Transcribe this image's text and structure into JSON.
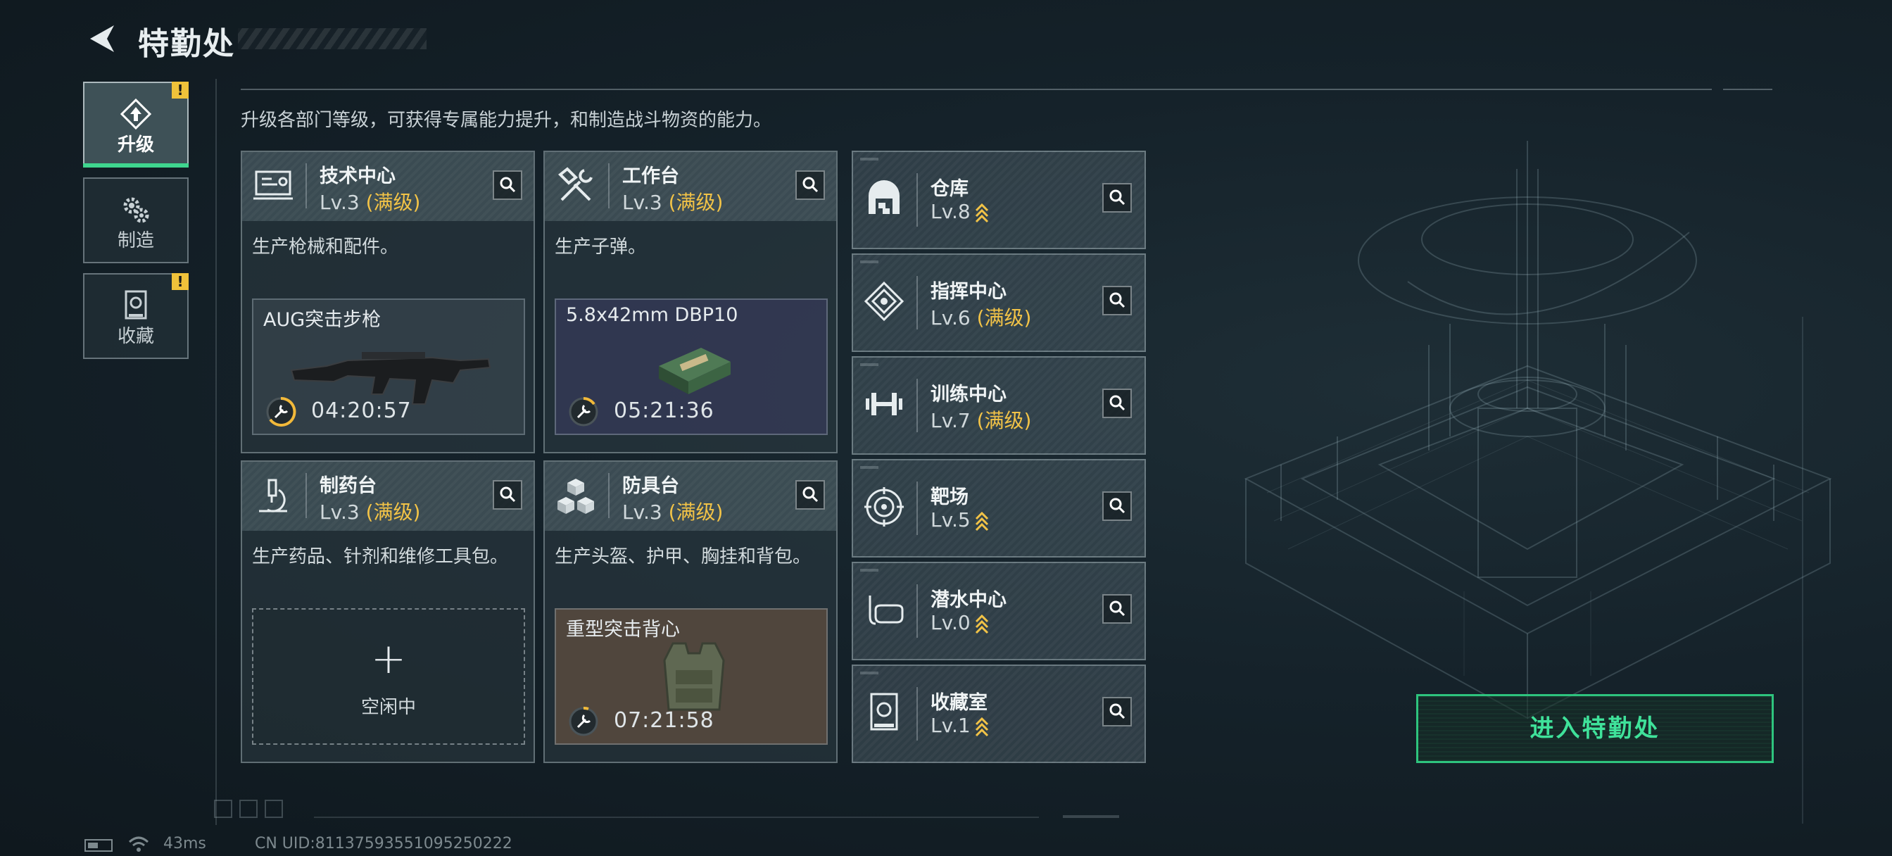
{
  "header": {
    "title": "特勤处"
  },
  "subtitle": "升级各部门等级，可获得专属能力提升，和制造战斗物资的能力。",
  "nav": [
    {
      "label": "升级",
      "icon": "upgrade-icon",
      "active": true,
      "alert": "!"
    },
    {
      "label": "制造",
      "icon": "gears-icon",
      "active": false
    },
    {
      "label": "收藏",
      "icon": "collection-icon",
      "active": false,
      "alert": "!"
    }
  ],
  "cards": [
    {
      "name": "技术中心",
      "level": "Lv.3",
      "maxed": "(满级)",
      "icon": "monitor-icon",
      "desc": "生产枪械和配件。",
      "item": "AUG突击步枪",
      "timer": "04:20:57"
    },
    {
      "name": "工作台",
      "level": "Lv.3",
      "maxed": "(满级)",
      "icon": "tools-icon",
      "desc": "生产子弹。",
      "item": "5.8x42mm DBP10",
      "timer": "05:21:36"
    },
    {
      "name": "制药台",
      "level": "Lv.3",
      "maxed": "(满级)",
      "icon": "microscope-icon",
      "desc": "生产药品、针剂和维修工具包。",
      "empty_plus": "+",
      "empty_label": "空闲中"
    },
    {
      "name": "防具台",
      "level": "Lv.3",
      "maxed": "(满级)",
      "icon": "cubes-icon",
      "desc": "生产头盔、护甲、胸挂和背包。",
      "item": "重型突击背心",
      "timer": "07:21:58"
    }
  ],
  "small_cards": [
    {
      "name": "仓库",
      "level": "Lv.8",
      "upgradable": true,
      "icon": "warehouse-icon"
    },
    {
      "name": "指挥中心",
      "level": "Lv.6",
      "maxed": "(满级)",
      "icon": "command-icon"
    },
    {
      "name": "训练中心",
      "level": "Lv.7",
      "maxed": "(满级)",
      "icon": "dumbbell-icon"
    },
    {
      "name": "靶场",
      "level": "Lv.5",
      "upgradable": true,
      "icon": "target-icon"
    },
    {
      "name": "潜水中心",
      "level": "Lv.0",
      "upgradable": true,
      "icon": "diving-mask-icon"
    },
    {
      "name": "收藏室",
      "level": "Lv.1",
      "upgradable": true,
      "icon": "display-case-icon"
    }
  ],
  "enter_button": "进入特勤处",
  "status": {
    "ping": "43ms",
    "uid": "CN UID:81137593551095250222"
  },
  "colors": {
    "accent_green": "#3fe29a",
    "maxed_gold": "#f2c347",
    "alert_yellow": "#f0c23a"
  }
}
